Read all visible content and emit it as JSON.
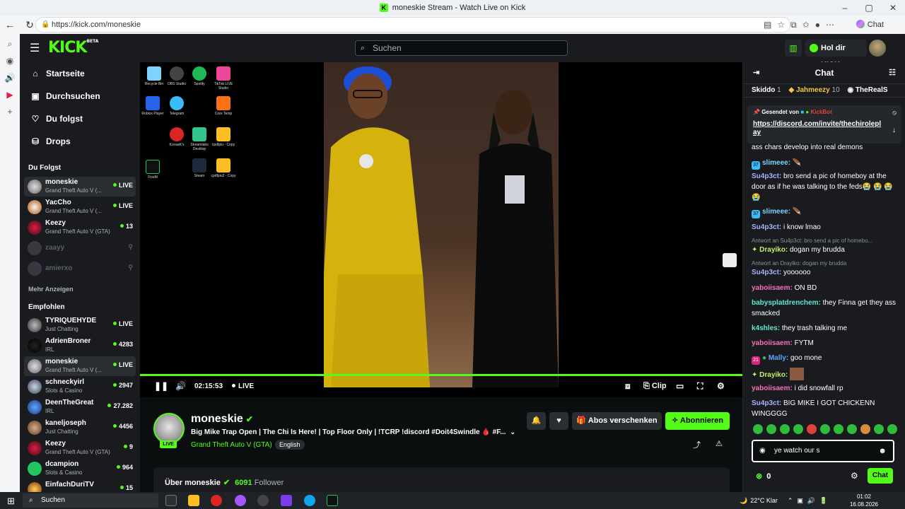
{
  "window": {
    "title": "moneskie Stream - Watch Live on Kick",
    "controls": [
      "–",
      "▢",
      "✕"
    ]
  },
  "browser": {
    "url": "https://kick.com/moneskie",
    "copilot_label": "Chat"
  },
  "topbar": {
    "logo": "KICK",
    "logo_sup": "BETA",
    "search_placeholder": "Suchen",
    "kicks_label": "Hol dir KICKs"
  },
  "sidebar": {
    "nav": [
      {
        "label": "Startseite",
        "icon": "home-icon"
      },
      {
        "label": "Durchsuchen",
        "icon": "browse-icon"
      },
      {
        "label": "Du folgst",
        "icon": "heart-icon"
      },
      {
        "label": "Drops",
        "icon": "drops-icon"
      }
    ],
    "following_title": "Du Folgst",
    "following": [
      {
        "name": "moneskie",
        "game": "Grand Theft Auto V (...",
        "status": "LIVE",
        "active": true
      },
      {
        "name": "YacCho",
        "game": "Grand Theft Auto V (...",
        "status": "LIVE"
      },
      {
        "name": "Keezy",
        "game": "Grand Theft Auto V (GTA)",
        "status": "13"
      },
      {
        "name": "zaayy",
        "offline": true
      },
      {
        "name": "amierxo",
        "offline": true
      }
    ],
    "more_label": "Mehr Anzeigen",
    "recommended_title": "Empfohlen",
    "recommended": [
      {
        "name": "TYRIQUEHYDE",
        "game": "Just Chatting",
        "status": "LIVE"
      },
      {
        "name": "AdrienBroner",
        "game": "IRL",
        "status": "4283"
      },
      {
        "name": "moneskie",
        "game": "Grand Theft Auto V (...",
        "status": "LIVE",
        "active": true
      },
      {
        "name": "schneckyirl",
        "game": "Slots & Casino",
        "status": "2947"
      },
      {
        "name": "DeenTheGreat",
        "game": "IRL",
        "status": "27.282"
      },
      {
        "name": "kaneljoseph",
        "game": "Just Chatting",
        "status": "4456"
      },
      {
        "name": "Keezy",
        "game": "Grand Theft Auto V (GTA)",
        "status": "9"
      },
      {
        "name": "dcampion",
        "game": "Slots & Casino",
        "status": "964"
      },
      {
        "name": "EinfachDuriTV",
        "game": "",
        "status": "15"
      }
    ]
  },
  "player": {
    "time": "02:15:53",
    "live_label": "LIVE",
    "clip_label": "Clip",
    "desktop_icons": [
      "Recycle Bin",
      "OBS Studio",
      "Spotify",
      "TikTok LIVE Studio",
      "Roblox Player",
      "Telegram",
      "Core Temp",
      "KovaaK's",
      "Streamlabs Desktop",
      "cpdfpiu - Copy",
      "FiveM",
      "Steam",
      "cpdfpiu2 - Copy"
    ]
  },
  "stream": {
    "streamer": "moneskie",
    "live_badge": "LIVE",
    "title": "Big Mike Trap Open | The Chi Is Here! | Top Floor Only | !TCRP !discord #Doit4Swindle 🩸 #F...",
    "game": "Grand Theft Auto V (GTA)",
    "language": "English",
    "gift_label": "Abos verschenken",
    "subscribe_label": "Abonnieren",
    "about_label": "Über moneskie",
    "followers": "6091",
    "followers_label": "Follower"
  },
  "chat": {
    "title": "Chat",
    "gifters": [
      {
        "name": "Skiddo",
        "count": "1"
      },
      {
        "name": "Jahmeezy",
        "count": "10"
      },
      {
        "name": "TheRealS",
        "count": ""
      }
    ],
    "pinned": {
      "from_label": "Gesendet von",
      "bot": "KickBot",
      "link": "https://discord.com/invite/thechiroleplay"
    },
    "messages": [
      {
        "user": "",
        "text": "ass chars develop into real demons",
        "color": "#ffffff"
      },
      {
        "user": "slimeee:",
        "text": "🪶",
        "color": "#7dd3fc",
        "badge": "37"
      },
      {
        "user": "Su4p3ct:",
        "text": "bro send a pic of homeboy at the door as if he was talking to the feds😭 😭 😭 😭",
        "color": "#a5b4fc"
      },
      {
        "user": "slimeee:",
        "text": "🪶",
        "color": "#7dd3fc",
        "badge": "37"
      },
      {
        "user": "Su4p3ct:",
        "text": "i know lmao",
        "color": "#a5b4fc"
      },
      {
        "user": "Drayiko:",
        "text": "dogan my brudda",
        "color": "#bef264",
        "reply": "Antwort an Su4p3ct: bro send a pic of homebo..."
      },
      {
        "user": "Su4p3ct:",
        "text": "yoooooo",
        "color": "#a5b4fc",
        "reply": "Antwort an Drayiko: dogan my brudda"
      },
      {
        "user": "yaboiisaem:",
        "text": "ON BD",
        "color": "#f472b6"
      },
      {
        "user": "babysplatdrenchem:",
        "text": "they Finna get they ass smacked",
        "color": "#5eead4"
      },
      {
        "user": "k4shles:",
        "text": "they trash talking me",
        "color": "#5eead4"
      },
      {
        "user": "yaboiisaem:",
        "text": "FYTM",
        "color": "#f472b6"
      },
      {
        "user": "Mally:",
        "text": "goo mone",
        "color": "#60a5fa",
        "badge": "21"
      },
      {
        "user": "Drayiko:",
        "text": "",
        "color": "#bef264"
      },
      {
        "user": "yaboiisaem:",
        "text": "i did snowfall rp",
        "color": "#f472b6"
      },
      {
        "user": "Su4p3ct:",
        "text": "BIG MIKE I GOT CHICKENN WINGGGG",
        "color": "#a5b4fc"
      }
    ],
    "input_value": "ye watch our s",
    "points": "0",
    "send_label": "Chat"
  },
  "taskbar": {
    "search_placeholder": "Suchen",
    "weather": "22°C  Klar",
    "time": "01:02",
    "date": "16.08.2026"
  }
}
